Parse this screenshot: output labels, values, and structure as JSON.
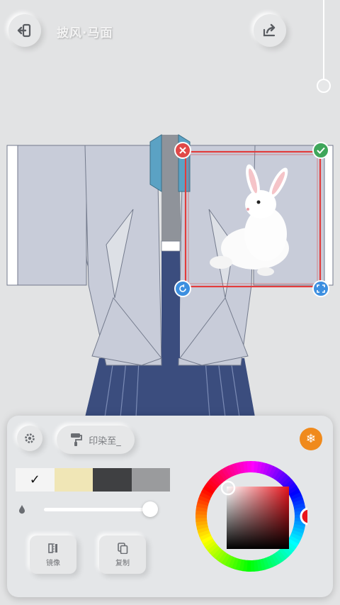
{
  "header": {
    "title": "披风·马面",
    "back_icon": "exit-icon",
    "share_icon": "share-icon"
  },
  "canvas": {
    "colors": {
      "robe": "#c8ccd9",
      "collar": "#5ba2c4",
      "skirt": "#3b4d7e",
      "inner": "#8f939a",
      "selection": "#e23c3c"
    },
    "handles": {
      "delete_icon": "close-icon",
      "confirm_icon": "check-icon",
      "rotate_icon": "rotate-icon",
      "scale_icon": "expand-icon"
    }
  },
  "panel": {
    "settings_icon": "gear-icon",
    "print_to": {
      "icon": "paint-roller-icon",
      "label": "印染至_"
    },
    "freeze_icon": "snowflake-icon",
    "swatches": [
      {
        "color": "#f4f4f4",
        "selected": true
      },
      {
        "color": "#f0e6b6",
        "selected": false
      },
      {
        "color": "#3f4042",
        "selected": false
      },
      {
        "color": "#9a9b9d",
        "selected": false
      }
    ],
    "opacity": {
      "icon": "droplet-icon",
      "value": 1.0
    },
    "mirror": {
      "icon": "mirror-icon",
      "label": "镜像"
    },
    "copy": {
      "icon": "copy-icon",
      "label": "复制"
    },
    "color_picker": {
      "hue_color": "#e8141c",
      "selected_color": "#e8141c"
    }
  }
}
